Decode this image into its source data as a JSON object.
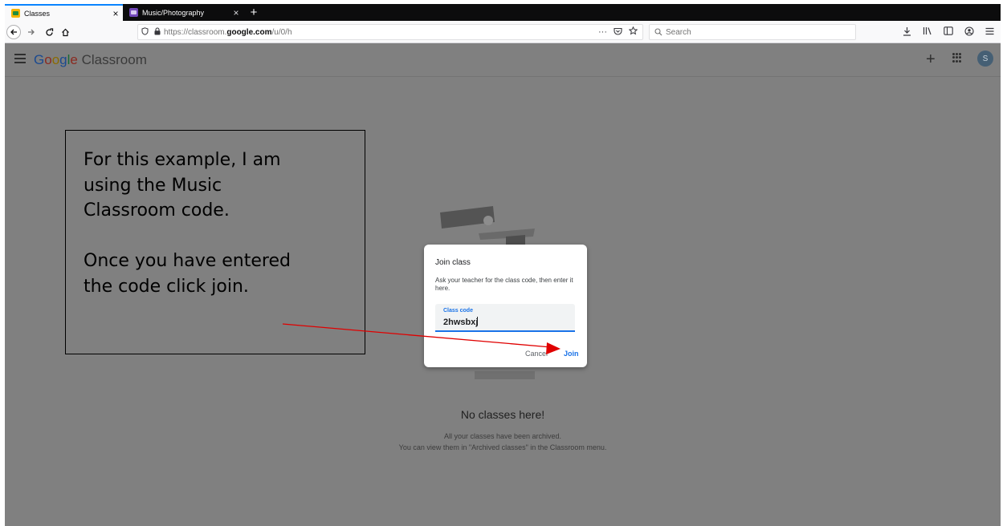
{
  "browser": {
    "tabs": [
      {
        "title": "Classes",
        "active": true
      },
      {
        "title": "Music/Photography",
        "active": false
      }
    ],
    "tab_close_glyph": "×",
    "new_tab_glyph": "+",
    "url": {
      "prefix": "https://classroom.",
      "host": "google.com",
      "path": "/u/0/h"
    },
    "url_actions_glyph": "···",
    "search_placeholder": "Search"
  },
  "app": {
    "logo_google": [
      "G",
      "o",
      "o",
      "g",
      "l",
      "e"
    ],
    "logo_product": " Classroom",
    "avatar_initial": "S",
    "plus_glyph": "+"
  },
  "empty_state": {
    "title": "No classes here!",
    "line1": "All your classes have been archived.",
    "line2": "You can view them in \"Archived classes\" in the Classroom menu."
  },
  "dialog": {
    "title": "Join class",
    "description": "Ask your teacher for the class code, then enter it here.",
    "field_label": "Class code",
    "field_value": "2hwsbxj",
    "cancel_label": "Cancel",
    "join_label": "Join"
  },
  "callout": {
    "line1": "For this example, I am",
    "line2": "using the Music",
    "line3": "Classroom code.",
    "line4": "Once you have entered",
    "line5": "the code click join."
  },
  "colors": {
    "accent": "#1a73e8",
    "annotation_arrow": "#ff0000",
    "overlay": "#808080"
  }
}
